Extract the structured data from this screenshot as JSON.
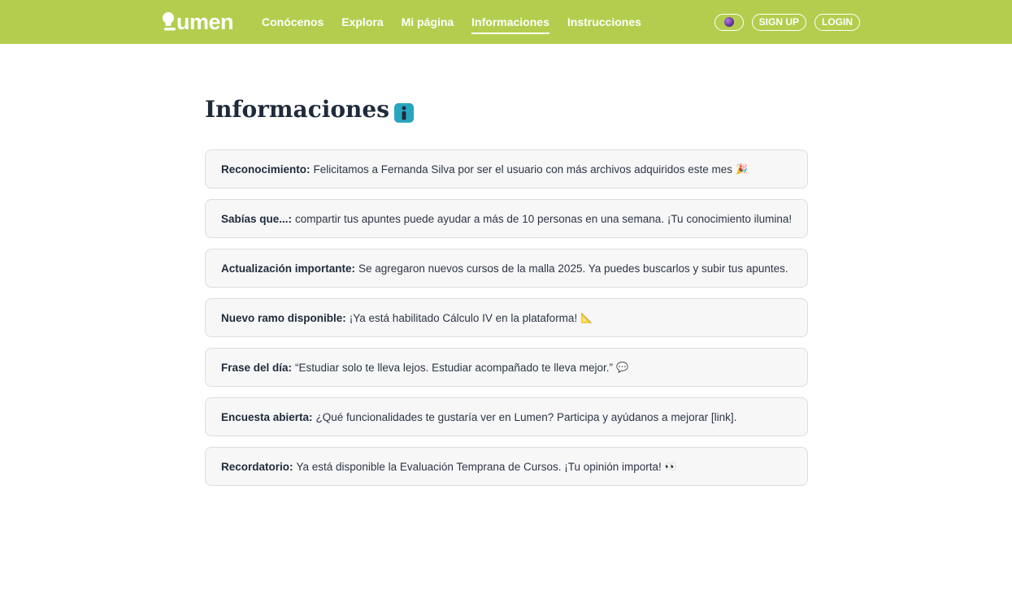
{
  "header": {
    "logo_text": "umen",
    "nav": [
      "Conócenos",
      "Explora",
      "Mi página",
      "Informaciones",
      "Instrucciones"
    ],
    "active_nav": "Informaciones",
    "signup_label": "SIGN UP",
    "login_label": "LOGIN",
    "accent_color": "#b3ce4e"
  },
  "page": {
    "title": "Informaciones",
    "title_icon": "info-icon"
  },
  "notices": [
    {
      "label": "Reconocimiento:",
      "text": "Felicitamos a Fernanda Silva por ser el usuario con más archivos adquiridos este mes",
      "emoji": "🎉"
    },
    {
      "label": "Sabías que...:",
      "text": "compartir tus apuntes puede ayudar a más de 10 personas en una semana. ¡Tu conocimiento ilumina!",
      "emoji": ""
    },
    {
      "label": "Actualización importante:",
      "text": "Se agregaron nuevos cursos de la malla 2025. Ya puedes buscarlos y subir tus apuntes.",
      "emoji": ""
    },
    {
      "label": "Nuevo ramo disponible:",
      "text": "¡Ya está habilitado Cálculo IV en la plataforma!",
      "emoji": "📐"
    },
    {
      "label": "Frase del día:",
      "text": "“Estudiar solo te lleva lejos. Estudiar acompañado te lleva mejor.”",
      "emoji": "💬"
    },
    {
      "label": "Encuesta abierta:",
      "text": "¿Qué funcionalidades te gustaría ver en Lumen? Participa y ayúdanos a mejorar [link].",
      "emoji": ""
    },
    {
      "label": "Recordatorio:",
      "text": "Ya está disponible la Evaluación Temprana de Cursos. ¡Tu opinión importa!",
      "emoji": "👀"
    }
  ]
}
